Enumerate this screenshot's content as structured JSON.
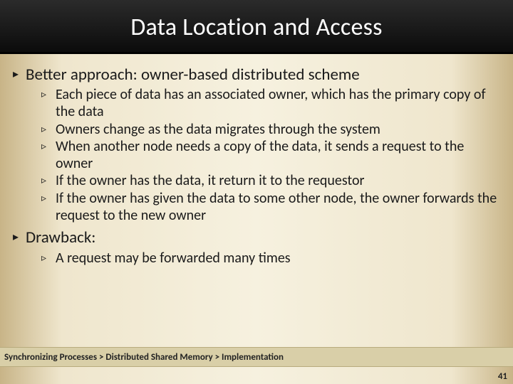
{
  "title": "Data Location and Access",
  "bullets": [
    {
      "text": "Better approach: owner-based distributed scheme",
      "sub": [
        "Each piece of data has an associated owner, which has the primary copy of the data",
        "Owners change as the data migrates through the system",
        "When another node needs a copy of the data, it sends a request to the owner",
        "If the owner has the data, it return it to the requestor",
        "If the owner has given the data to some other node, the owner forwards the request to the new owner"
      ]
    },
    {
      "text": "Drawback:",
      "sub": [
        "A request may be forwarded many times"
      ]
    }
  ],
  "breadcrumb": "Synchronizing Processes > Distributed Shared Memory > Implementation",
  "page_number": "41",
  "markers": {
    "level1": "▸",
    "level2": "▹"
  }
}
